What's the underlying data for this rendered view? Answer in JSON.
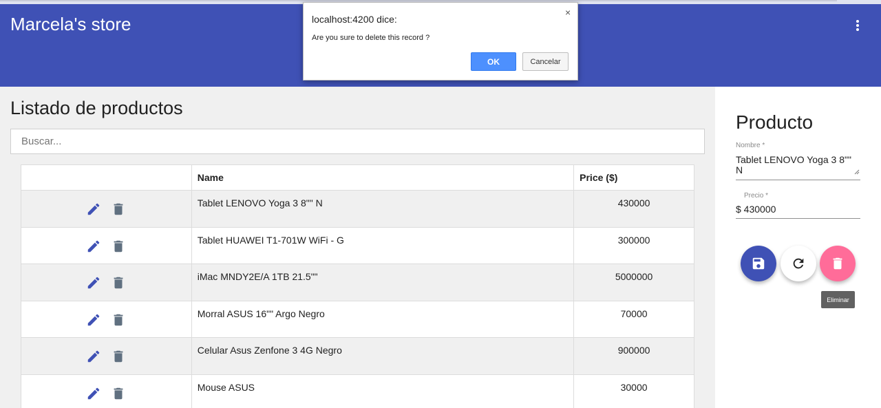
{
  "app": {
    "store_title": "Marcela's store",
    "more_icon": "more-vert-icon",
    "header_color": "#3f51b5"
  },
  "list": {
    "title": "Listado de productos",
    "search_placeholder": "Buscar...",
    "columns": [
      "",
      "Name",
      "Price ($)"
    ],
    "rows": [
      {
        "name": "Tablet LENOVO Yoga 3 8\"\" N",
        "price": "430000"
      },
      {
        "name": "Tablet HUAWEI T1-701W WiFi - G",
        "price": "300000"
      },
      {
        "name": "iMac MNDY2E/A 1TB 21.5\"\"",
        "price": "5000000"
      },
      {
        "name": "Morral ASUS 16\"\" Argo Negro",
        "price": "70000"
      },
      {
        "name": "Celular Asus Zenfone 3 4G Negro",
        "price": "900000"
      },
      {
        "name": "Mouse ASUS",
        "price": "30000"
      }
    ],
    "row_icons": [
      "edit-icon",
      "delete-icon"
    ]
  },
  "form": {
    "title": "Producto",
    "nombre_label": "Nombre *",
    "nombre_value": "Tablet LENOVO Yoga 3 8\"\" N",
    "precio_label": "Precio *",
    "precio_value": "$ 430000",
    "buttons": [
      "save-icon",
      "refresh-icon",
      "delete-icon"
    ],
    "tooltip": "Eliminar",
    "colors": {
      "save": "#3f51b5",
      "refresh": "#ffffff",
      "delete": "#ff6c99"
    }
  },
  "dialog": {
    "title": "localhost:4200 dice:",
    "close": "×",
    "message": "Are you sure to delete this record ?",
    "ok_label": "OK",
    "cancel_label": "Cancelar"
  }
}
